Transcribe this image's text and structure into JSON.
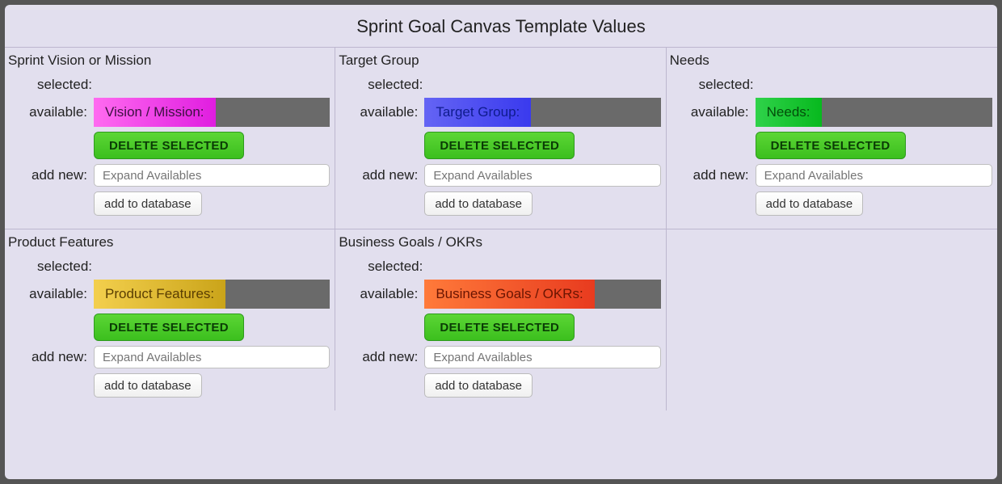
{
  "title": "Sprint Goal Canvas Template Values",
  "labels": {
    "selected": "selected:",
    "available": "available:",
    "addNew": "add new:"
  },
  "buttons": {
    "delete": "DELETE SELECTED",
    "addDb": "add to database"
  },
  "placeholders": {
    "expand": "Expand Availables"
  },
  "sections": [
    {
      "title": "Sprint Vision or Mission",
      "chip": "Vision / Mission:",
      "chipColor": "magenta"
    },
    {
      "title": "Target Group",
      "chip": "Target Group:",
      "chipColor": "blue"
    },
    {
      "title": "Needs",
      "chip": "Needs:",
      "chipColor": "green"
    },
    {
      "title": "Product Features",
      "chip": "Product Features:",
      "chipColor": "gold"
    },
    {
      "title": "Business Goals / OKRs",
      "chip": "Business Goals / OKRs:",
      "chipColor": "orange"
    }
  ]
}
